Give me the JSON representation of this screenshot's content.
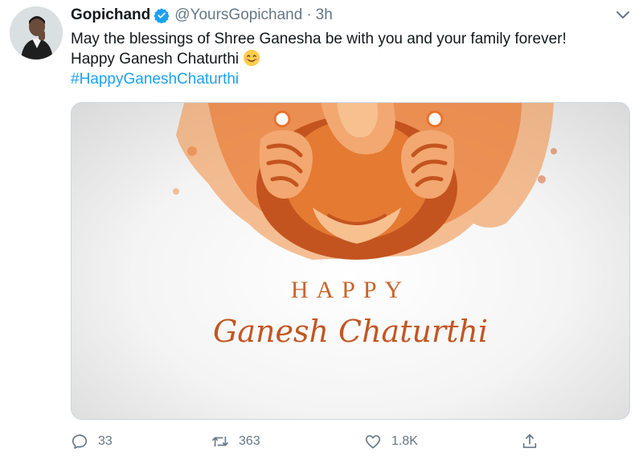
{
  "tweet": {
    "display_name": "Gopichand",
    "handle": "@YoursGopichand",
    "separator": "·",
    "time": "3h",
    "text_line1": "May the blessings of Shree Ganesha be with you and your family forever!",
    "text_line2": "Happy Ganesh Chaturthi",
    "hashtag": "#HappyGaneshChaturthi"
  },
  "media": {
    "happy_text": "HAPPY",
    "subtitle_text": "Ganesh Chaturthi"
  },
  "actions": {
    "replies": "33",
    "retweets": "363",
    "likes": "1.8K"
  },
  "colors": {
    "accent": "#1da1f2",
    "verified": "#1da1f2",
    "muted": "#657786",
    "orange": "#e8732d"
  },
  "icons": {
    "verified": "verified-badge-icon",
    "caret": "chevron-down-icon",
    "emoji": "smiling-face-emoji",
    "reply": "reply-icon",
    "retweet": "retweet-icon",
    "like": "heart-icon",
    "share": "share-icon"
  }
}
